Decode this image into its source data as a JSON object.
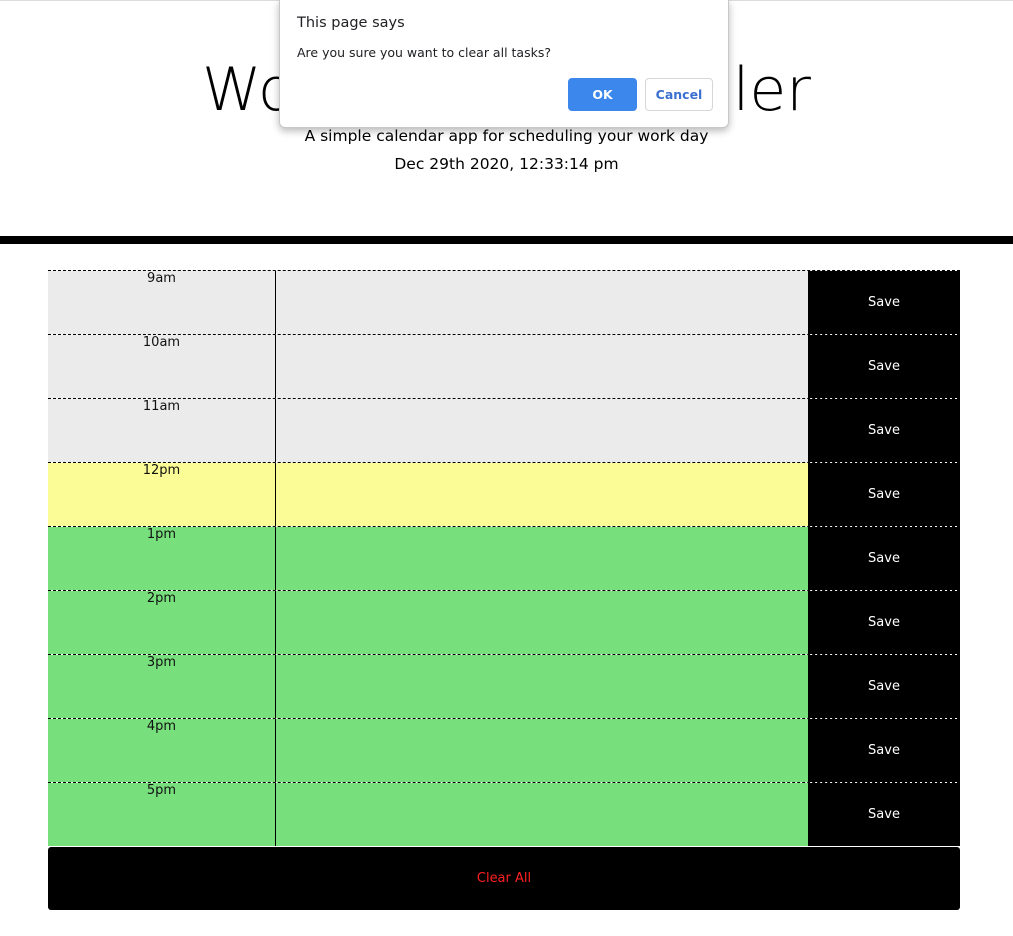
{
  "header": {
    "title": "Work Day Scheduler",
    "lead": "A simple calendar app for scheduling your work day",
    "current_day": "Dec 29th 2020, 12:33:14 pm"
  },
  "scheduler": {
    "save_label": "Save",
    "rows": [
      {
        "hour": "9am",
        "status": "past",
        "task": ""
      },
      {
        "hour": "10am",
        "status": "past",
        "task": ""
      },
      {
        "hour": "11am",
        "status": "past",
        "task": ""
      },
      {
        "hour": "12pm",
        "status": "present",
        "task": ""
      },
      {
        "hour": "1pm",
        "status": "future",
        "task": ""
      },
      {
        "hour": "2pm",
        "status": "future",
        "task": ""
      },
      {
        "hour": "3pm",
        "status": "future",
        "task": ""
      },
      {
        "hour": "4pm",
        "status": "future",
        "task": ""
      },
      {
        "hour": "5pm",
        "status": "future",
        "task": ""
      }
    ]
  },
  "clear_all_label": "Clear All",
  "dialog": {
    "origin": "This page says",
    "message": "Are you sure you want to clear all tasks?",
    "ok_label": "OK",
    "cancel_label": "Cancel"
  },
  "colors": {
    "past": "#ebebeb",
    "present": "#fbfc95",
    "future": "#77df7c",
    "clear_text": "#ff2020",
    "ok_button": "#3b87ec"
  }
}
